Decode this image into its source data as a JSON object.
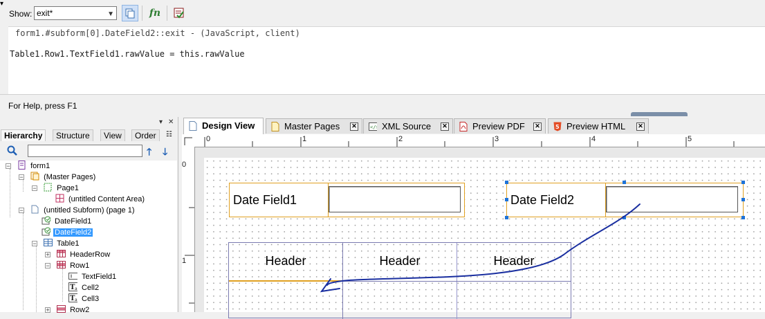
{
  "toolbar": {
    "show_label": "Show:",
    "show_value": "exit*"
  },
  "editor": {
    "header_line": "form1.#subform[0].DateField2::exit - (JavaScript, client)",
    "code_line": "Table1.Row1.TextField1.rawValue = this.rawValue"
  },
  "status": {
    "help_text": "For Help, press F1"
  },
  "left_panel": {
    "tabs": [
      {
        "label": "Hierarchy"
      },
      {
        "label": "Structure"
      },
      {
        "label": "View"
      },
      {
        "label": "Order"
      }
    ],
    "tree": [
      {
        "label": "form1"
      },
      {
        "label": "(Master Pages)"
      },
      {
        "label": "Page1"
      },
      {
        "label": "(untitled Content Area)"
      },
      {
        "label": "(untitled Subform) (page 1)"
      },
      {
        "label": "DateField1"
      },
      {
        "label": "DateField2"
      },
      {
        "label": "Table1"
      },
      {
        "label": "HeaderRow"
      },
      {
        "label": "Row1"
      },
      {
        "label": "TextField1"
      },
      {
        "label": "Cell2"
      },
      {
        "label": "Cell3"
      },
      {
        "label": "Row2"
      }
    ]
  },
  "design_tabs": [
    {
      "label": "Design View"
    },
    {
      "label": "Master Pages"
    },
    {
      "label": "XML Source"
    },
    {
      "label": "Preview PDF"
    },
    {
      "label": "Preview HTML"
    }
  ],
  "ruler": {
    "top": [
      "0",
      "1",
      "2",
      "3",
      "4",
      "5"
    ],
    "left": [
      "0",
      "1"
    ]
  },
  "form": {
    "date_field1_caption": "Date Field1",
    "date_field2_caption": "Date Field2",
    "table_headers": [
      "Header",
      "Header",
      "Header"
    ]
  },
  "colors": {
    "selection": "#3399ff",
    "field_border": "#e0a020",
    "handle": "#1e73d8",
    "annotation_ink": "#1a2fa0"
  }
}
